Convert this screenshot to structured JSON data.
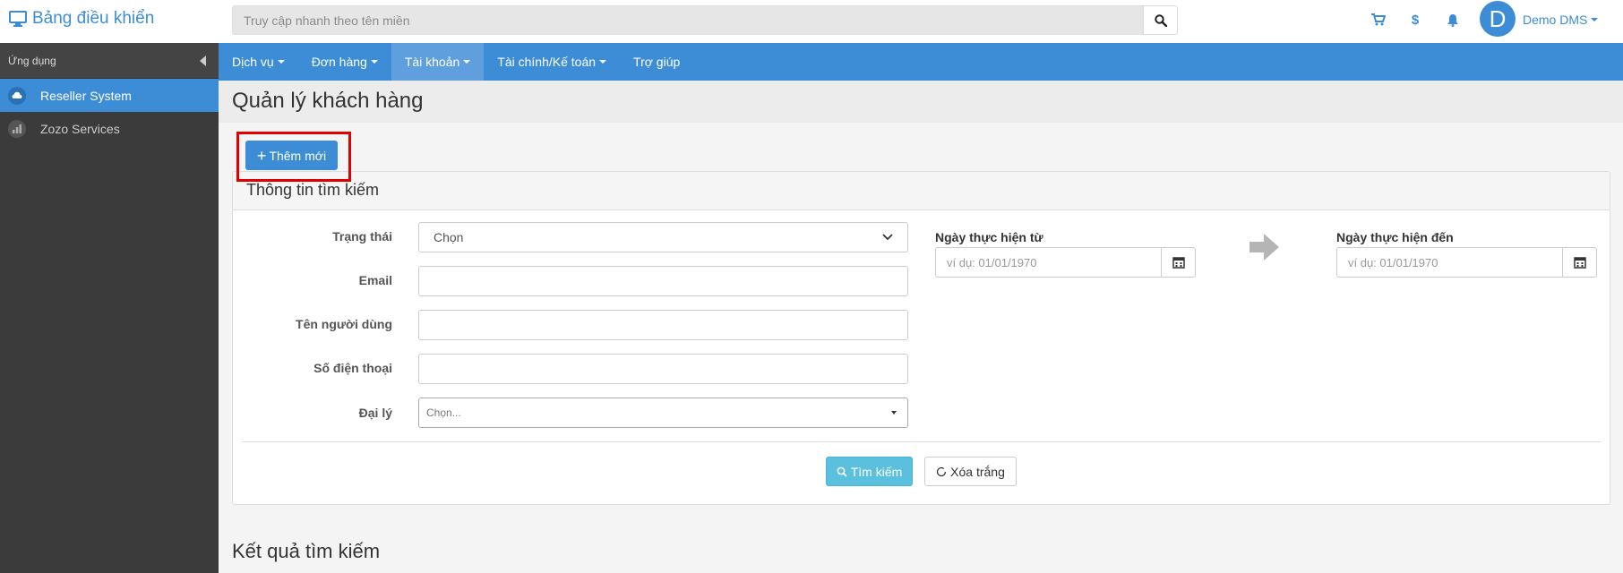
{
  "header": {
    "brand": "Bảng điều khiển",
    "search_placeholder": "Truy cập nhanh theo tên miền",
    "user_initial": "D",
    "user_name": "Demo DMS",
    "dollar_symbol": "$"
  },
  "sidebar": {
    "heading": "Ứng dụng",
    "items": [
      {
        "label": "Reseller System",
        "active": true
      },
      {
        "label": "Zozo Services",
        "active": false
      }
    ]
  },
  "nav": {
    "items": [
      {
        "label": "Dịch vụ",
        "active": false
      },
      {
        "label": "Đơn hàng",
        "active": false
      },
      {
        "label": "Tài khoản",
        "active": true
      },
      {
        "label": "Tài chính/Kế toán",
        "active": false
      },
      {
        "label": "Trợ giúp",
        "active": false
      }
    ]
  },
  "page": {
    "title": "Quản lý khách hàng",
    "add_button": "Thêm mới",
    "add_plus": "+",
    "panel_title": "Thông tin tìm kiếm",
    "results_title": "Kết quả tìm kiếm"
  },
  "form": {
    "status_label": "Trạng thái",
    "status_value": "Chọn",
    "email_label": "Email",
    "email_value": "",
    "username_label": "Tên người dùng",
    "username_value": "",
    "phone_label": "Số điện thoại",
    "phone_value": "",
    "agent_label": "Đại lý",
    "agent_value": "Chọn...",
    "date_from_label": "Ngày thực hiện từ",
    "date_from_placeholder": "ví dụ: 01/01/1970",
    "date_to_label": "Ngày thực hiện đến",
    "date_to_placeholder": "ví dụ: 01/01/1970",
    "search_button": "Tìm kiếm",
    "reset_button": "Xóa trắng"
  },
  "colors": {
    "primary": "#3c8dd6",
    "info": "#5bc0de",
    "highlight": "#e00000",
    "sidebar": "#3b3b3b"
  }
}
